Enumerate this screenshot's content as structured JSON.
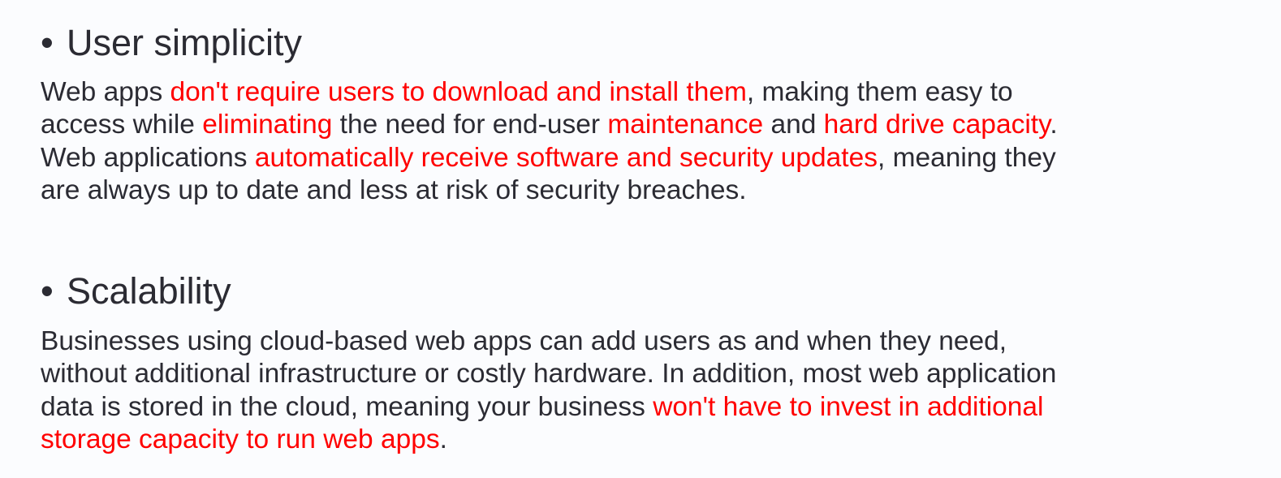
{
  "colors": {
    "text": "#2b2b33",
    "highlight": "#ff0000",
    "background": "#fbfcfe"
  },
  "sections": [
    {
      "bullet": "•",
      "title": "User simplicity",
      "lines": [
        [
          {
            "t": "Web apps ",
            "hl": false
          },
          {
            "t": "don't require users to download and install them",
            "hl": true
          },
          {
            "t": ", making them easy to",
            "hl": false
          }
        ],
        [
          {
            "t": "access while ",
            "hl": false
          },
          {
            "t": "eliminating",
            "hl": true
          },
          {
            "t": " the need for end-user ",
            "hl": false
          },
          {
            "t": "maintenance",
            "hl": true
          },
          {
            "t": " and ",
            "hl": false
          },
          {
            "t": "hard drive capacity",
            "hl": true
          },
          {
            "t": ".",
            "hl": false
          }
        ],
        [
          {
            "t": "Web applications ",
            "hl": false
          },
          {
            "t": "automatically receive software and security updates",
            "hl": true
          },
          {
            "t": ", meaning they",
            "hl": false
          }
        ],
        [
          {
            "t": "are always up to date and less at risk of security breaches.",
            "hl": false
          }
        ]
      ]
    },
    {
      "bullet": "•",
      "title": "Scalability",
      "lines": [
        [
          {
            "t": "Businesses using cloud-based web apps can add users as and when they need,",
            "hl": false
          }
        ],
        [
          {
            "t": "without additional infrastructure or costly hardware. In addition, most web application",
            "hl": false
          }
        ],
        [
          {
            "t": "data is stored in the cloud, meaning your business ",
            "hl": false
          },
          {
            "t": "won't have to invest in additional",
            "hl": true
          }
        ],
        [
          {
            "t": "storage capacity to run web apps",
            "hl": true
          },
          {
            "t": ".",
            "hl": false
          }
        ]
      ]
    }
  ]
}
